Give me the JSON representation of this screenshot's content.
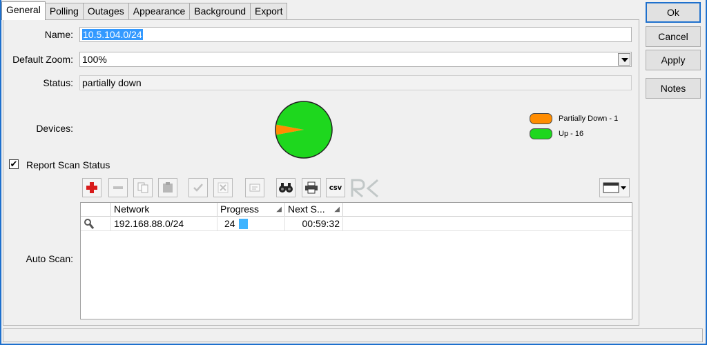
{
  "tabs": [
    "General",
    "Polling",
    "Outages",
    "Appearance",
    "Background",
    "Export"
  ],
  "form": {
    "name_label": "Name:",
    "name_value": "10.5.104.0/24",
    "zoom_label": "Default Zoom:",
    "zoom_value": "100%",
    "status_label": "Status:",
    "status_value": "partially down",
    "devices_label": "Devices:",
    "report_scan_label": "Report Scan Status",
    "report_scan_checked": "✔",
    "auto_scan_label": "Auto Scan:"
  },
  "chart_data": {
    "type": "pie",
    "slices": [
      {
        "label": "Partially Down - 1",
        "value": 1,
        "color": "#ff8c00"
      },
      {
        "label": "Up - 16",
        "value": 16,
        "color": "#1ed71e"
      }
    ]
  },
  "toolbar": {
    "icons": [
      "add-icon",
      "remove-icon",
      "copy-icon",
      "paste-icon",
      "enable-icon",
      "disable-icon",
      "comment-icon",
      "find-icon",
      "print-icon",
      "csv-icon",
      "rk-logo-icon",
      "columns-icon"
    ],
    "csv_label": "csv"
  },
  "table": {
    "columns": [
      "Network",
      "Progress",
      "Next S..."
    ],
    "rows": [
      {
        "network": "192.168.88.0/24",
        "progress": "24",
        "progress_value": 0.24,
        "next": "00:59:32"
      }
    ]
  },
  "buttons": {
    "ok": "Ok",
    "cancel": "Cancel",
    "apply": "Apply",
    "notes": "Notes"
  },
  "colors": {
    "accent": "#1e70cd",
    "selection": "#3399ff",
    "progress": "#3fb4ff"
  }
}
